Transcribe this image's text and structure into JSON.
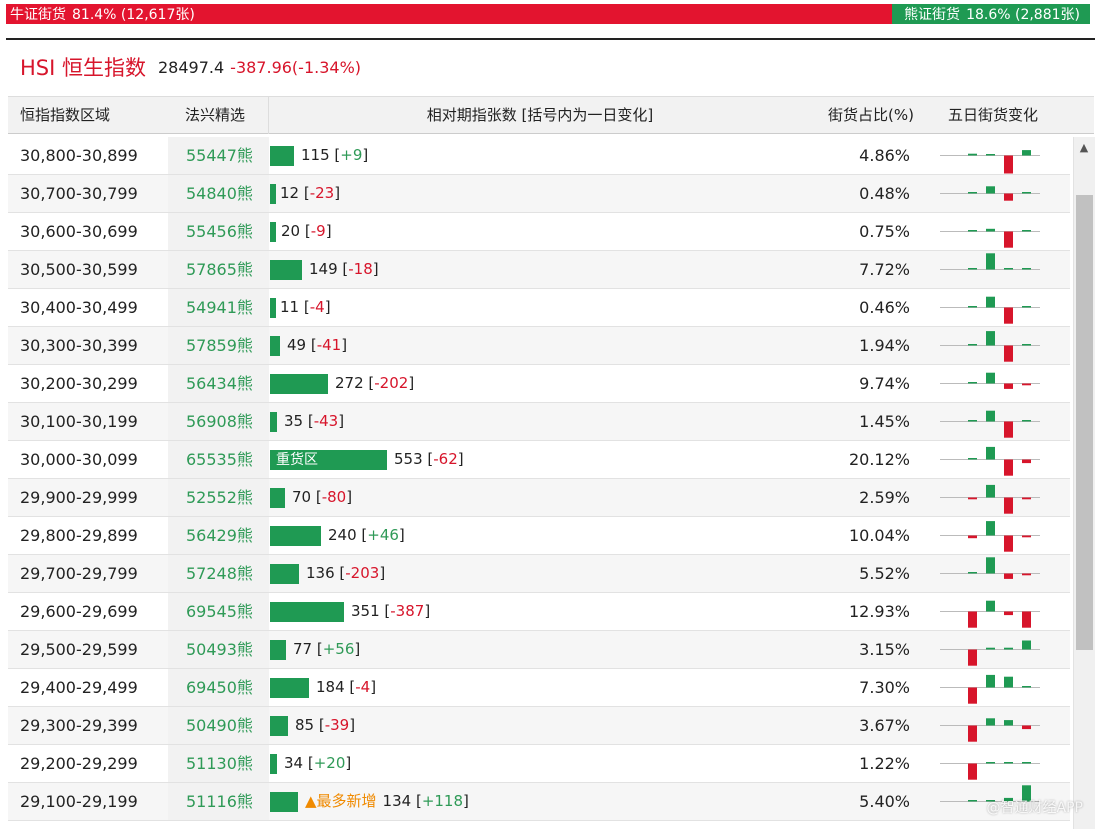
{
  "ratio": {
    "bull_label": "牛证街货",
    "bull_value": "81.4% (12,617张)",
    "bear_label": "熊证街货",
    "bear_value": "18.6% (2,881张)"
  },
  "index": {
    "name": "HSI 恒生指数",
    "value": "28497.4",
    "change": "-387.96(-1.34%)"
  },
  "columns": {
    "range": "恒指指数区域",
    "pick": "法兴精选",
    "bar": "相对期指张数 [括号内为一日变化]",
    "pct": "街货占比(%)",
    "five_day": "五日街货变化"
  },
  "colors": {
    "up": "#2f9a57",
    "down": "#d7152b",
    "bar": "#1f9a53",
    "tag": "#f08a00"
  },
  "rows": [
    {
      "range": "30,800-30,899",
      "pick": "55447熊",
      "count": 115,
      "count_text": "115",
      "delta": "+9",
      "pct": "4.86%",
      "spark": [
        0.1,
        0,
        -1,
        0.3,
        0.1
      ]
    },
    {
      "range": "30,700-30,799",
      "pick": "54840熊",
      "count": 12,
      "count_text": "12",
      "delta": "-23",
      "pct": "0.48%",
      "spark": [
        0,
        0.4,
        -0.4,
        0,
        -0.9
      ]
    },
    {
      "range": "30,600-30,699",
      "pick": "55456熊",
      "count": 20,
      "count_text": "20",
      "delta": "-9",
      "pct": "0.75%",
      "spark": [
        0,
        0.15,
        -0.9,
        0.05,
        -0.05
      ]
    },
    {
      "range": "30,500-30,599",
      "pick": "57865熊",
      "count": 149,
      "count_text": "149",
      "delta": "-18",
      "pct": "7.72%",
      "spark": [
        0,
        0.9,
        0.05,
        0.05,
        -0.15
      ]
    },
    {
      "range": "30,400-30,499",
      "pick": "54941熊",
      "count": 11,
      "count_text": "11",
      "delta": "-4",
      "pct": "0.46%",
      "spark": [
        0,
        0.6,
        -0.9,
        0.05,
        -0.05
      ]
    },
    {
      "range": "30,300-30,399",
      "pick": "57859熊",
      "count": 49,
      "count_text": "49",
      "delta": "-41",
      "pct": "1.94%",
      "spark": [
        0,
        0.8,
        -0.9,
        0,
        -0.3
      ]
    },
    {
      "range": "30,200-30,299",
      "pick": "56434熊",
      "count": 272,
      "count_text": "272",
      "delta": "-202",
      "pct": "9.74%",
      "spark": [
        0,
        0.6,
        -0.3,
        -0.1,
        -0.9
      ]
    },
    {
      "range": "30,100-30,199",
      "pick": "56908熊",
      "count": 35,
      "count_text": "35",
      "delta": "-43",
      "pct": "1.45%",
      "spark": [
        0,
        0.6,
        -0.9,
        0.05,
        -0.5
      ]
    },
    {
      "range": "30,000-30,099",
      "pick": "65535熊",
      "count": 553,
      "count_text": "553",
      "delta": "-62",
      "pct": "20.12%",
      "tag": "重货区",
      "spark": [
        0,
        0.7,
        -0.9,
        -0.2,
        -0.2
      ]
    },
    {
      "range": "29,900-29,999",
      "pick": "52552熊",
      "count": 70,
      "count_text": "70",
      "delta": "-80",
      "pct": "2.59%",
      "spark": [
        -0.1,
        0.7,
        -0.9,
        -0.1,
        -0.7
      ]
    },
    {
      "range": "29,800-29,899",
      "pick": "56429熊",
      "count": 240,
      "count_text": "240",
      "delta": "+46",
      "pct": "10.04%",
      "spark": [
        -0.15,
        0.8,
        -0.9,
        -0.1,
        0.4
      ]
    },
    {
      "range": "29,700-29,799",
      "pick": "57248熊",
      "count": 136,
      "count_text": "136",
      "delta": "-203",
      "pct": "5.52%",
      "spark": [
        0,
        0.9,
        -0.3,
        -0.1,
        -0.9
      ]
    },
    {
      "range": "29,600-29,699",
      "pick": "69545熊",
      "count": 351,
      "count_text": "351",
      "delta": "-387",
      "pct": "12.93%",
      "spark": [
        -0.9,
        0.6,
        -0.2,
        -0.9,
        0
      ]
    },
    {
      "range": "29,500-29,599",
      "pick": "50493熊",
      "count": 77,
      "count_text": "77",
      "delta": "+56",
      "pct": "3.15%",
      "spark": [
        -0.9,
        0.1,
        0.1,
        0.5,
        0
      ]
    },
    {
      "range": "29,400-29,499",
      "pick": "69450熊",
      "count": 184,
      "count_text": "184",
      "delta": "-4",
      "pct": "7.30%",
      "spark": [
        -0.9,
        0.7,
        0.6,
        0.05,
        0
      ]
    },
    {
      "range": "29,300-29,399",
      "pick": "50490熊",
      "count": 85,
      "count_text": "85",
      "delta": "-39",
      "pct": "3.67%",
      "spark": [
        -0.9,
        0.4,
        0.3,
        -0.2,
        0
      ]
    },
    {
      "range": "29,200-29,299",
      "pick": "51130熊",
      "count": 34,
      "count_text": "34",
      "delta": "+20",
      "pct": "1.22%",
      "spark": [
        -0.9,
        0.05,
        0.05,
        0.05,
        0
      ]
    },
    {
      "range": "29,100-29,199",
      "pick": "51116熊",
      "count": 134,
      "count_text": "134",
      "delta": "+118",
      "pct": "5.40%",
      "tag_new": "▲最多新增",
      "spark": [
        0,
        0.05,
        0.2,
        0.9,
        0
      ]
    }
  ],
  "watermark": "@智通财经APP"
}
